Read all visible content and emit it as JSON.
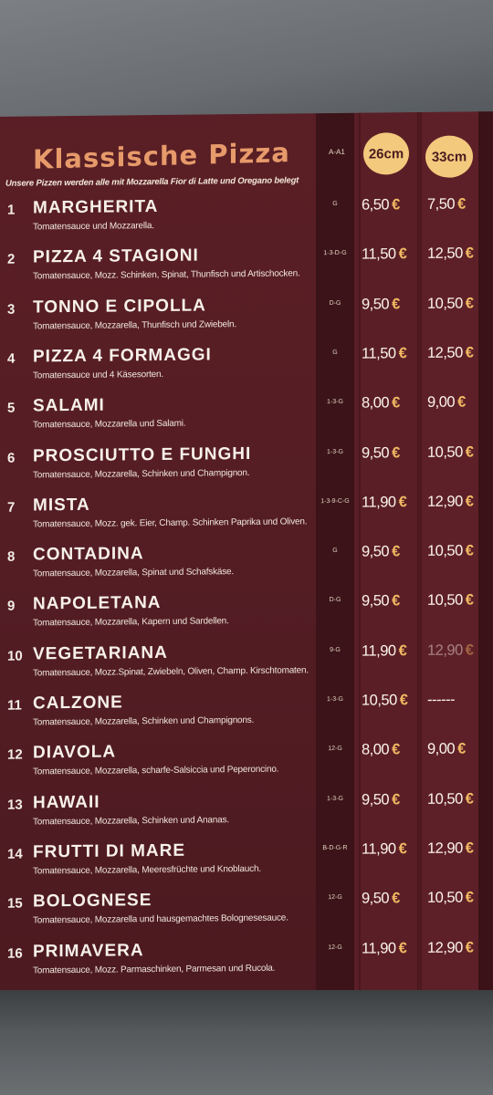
{
  "menu": {
    "title": "Klassische Pizza",
    "subtitle": "Unsere Pizzen werden alle mit Mozzarella Fior di Latte und Oregano belegt",
    "allergen_header": "A-A1",
    "size_small": "26cm",
    "size_large": "33cm",
    "currency": "€",
    "items": [
      {
        "num": "1",
        "name": "MARGHERITA",
        "desc": "Tomatensauce und Mozzarella.",
        "allergens": "G",
        "price_26": "6,50",
        "price_33": "7,50"
      },
      {
        "num": "2",
        "name": "PIZZA 4 STAGIONI",
        "desc": "Tomatensauce, Mozz. Schinken, Spinat, Thunfisch und Artischocken.",
        "allergens": "1-3-D-G",
        "price_26": "11,50",
        "price_33": "12,50"
      },
      {
        "num": "3",
        "name": "TONNO E CIPOLLA",
        "desc": "Tomatensauce, Mozzarella, Thunfisch und Zwiebeln.",
        "allergens": "D-G",
        "price_26": "9,50",
        "price_33": "10,50"
      },
      {
        "num": "4",
        "name": "PIZZA 4 FORMAGGI",
        "desc": "Tomatensauce und 4 Käsesorten.",
        "allergens": "G",
        "price_26": "11,50",
        "price_33": "12,50"
      },
      {
        "num": "5",
        "name": "SALAMI",
        "desc": "Tomatensauce, Mozzarella und Salami.",
        "allergens": "1-3-G",
        "price_26": "8,00",
        "price_33": "9,00"
      },
      {
        "num": "6",
        "name": "PROSCIUTTO E FUNGHI",
        "desc": "Tomatensauce, Mozzarella, Schinken und Champignon.",
        "allergens": "1-3-G",
        "price_26": "9,50",
        "price_33": "10,50"
      },
      {
        "num": "7",
        "name": "MISTA",
        "desc": "Tomatensauce, Mozz. gek. Eier, Champ. Schinken Paprika und Oliven.",
        "allergens": "1-3-9-C-G",
        "price_26": "11,90",
        "price_33": "12,90"
      },
      {
        "num": "8",
        "name": "CONTADINA",
        "desc": "Tomatensauce, Mozzarella, Spinat und Schafskäse.",
        "allergens": "G",
        "price_26": "9,50",
        "price_33": "10,50"
      },
      {
        "num": "9",
        "name": "NAPOLETANA",
        "desc": "Tomatensauce, Mozzarella, Kapern und Sardellen.",
        "allergens": "D-G",
        "price_26": "9,50",
        "price_33": "10,50"
      },
      {
        "num": "10",
        "name": "VEGETARIANA",
        "desc": "Tomatensauce, Mozz.Spinat, Zwiebeln, Oliven, Champ. Kirschtomaten.",
        "allergens": "9-G",
        "price_26": "11,90",
        "price_33": "12,90"
      },
      {
        "num": "11",
        "name": "CALZONE",
        "desc": "Tomatensauce, Mozzarella, Schinken und Champignons.",
        "allergens": "1-3-G",
        "price_26": "10,50",
        "price_33": "------"
      },
      {
        "num": "12",
        "name": "DIAVOLA",
        "desc": "Tomatensauce, Mozzarella, scharfe-Salsiccia und Peperoncino.",
        "allergens": "12-G",
        "price_26": "8,00",
        "price_33": "9,00"
      },
      {
        "num": "13",
        "name": "HAWAII",
        "desc": "Tomatensauce, Mozzarella, Schinken und Ananas.",
        "allergens": "1-3-G",
        "price_26": "9,50",
        "price_33": "10,50"
      },
      {
        "num": "14",
        "name": "FRUTTI DI MARE",
        "desc": "Tomatensauce, Mozzarella, Meeresfrüchte und Knoblauch.",
        "allergens": "B-D-G-R",
        "price_26": "11,90",
        "price_33": "12,90"
      },
      {
        "num": "15",
        "name": "BOLOGNESE",
        "desc": "Tomatensauce, Mozzarella und hausgemachtes Bolognesesauce.",
        "allergens": "12-G",
        "price_26": "9,50",
        "price_33": "10,50"
      },
      {
        "num": "16",
        "name": "PRIMAVERA",
        "desc": "Tomatensauce, Mozz. Parmaschinken, Parmesan und Rucola.",
        "allergens": "12-G",
        "price_26": "11,90",
        "price_33": "12,90"
      }
    ]
  },
  "colors": {
    "card_background": "#5a1e26",
    "title_orange": "#e79a6a",
    "size_badge": "#f3c97d",
    "euro_sign": "#f0b863",
    "counter_grey": "#6a6e72"
  }
}
